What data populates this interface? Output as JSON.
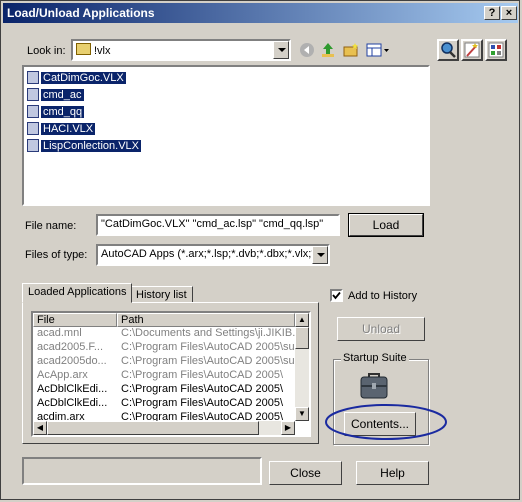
{
  "window": {
    "title": "Load/Unload Applications",
    "help_glyph": "?",
    "close_glyph": "×"
  },
  "look_in": {
    "label": "Look in:",
    "value": "!vlx"
  },
  "files": [
    "CatDimGoc.VLX",
    "cmd_ac",
    "cmd_qq",
    "HACI.VLX",
    "LispConlection.VLX"
  ],
  "file_name": {
    "label": "File name:",
    "value": "\"CatDimGoc.VLX\" \"cmd_ac.lsp\" \"cmd_qq.lsp\""
  },
  "file_type": {
    "label": "Files of type:",
    "value": "AutoCAD Apps (*.arx;*.lsp;*.dvb;*.dbx;*.vlx;*."
  },
  "buttons": {
    "load": "Load",
    "unload": "Unload",
    "contents": "Contents...",
    "close": "Close",
    "help": "Help"
  },
  "tabs": [
    "Loaded Applications",
    "History list"
  ],
  "add_to_history": {
    "label": "Add to History",
    "checked": true
  },
  "startup_suite": {
    "label": "Startup Suite"
  },
  "table": {
    "columns": [
      "File",
      "Path"
    ],
    "rows": [
      {
        "file": "acad.mnl",
        "path": "C:\\Documents and Settings\\ji.JIKIB...",
        "gray": true
      },
      {
        "file": "acad2005.F...",
        "path": "C:\\Program Files\\AutoCAD 2005\\su...",
        "gray": true
      },
      {
        "file": "acad2005do...",
        "path": "C:\\Program Files\\AutoCAD 2005\\su...",
        "gray": true
      },
      {
        "file": "AcApp.arx",
        "path": "C:\\Program Files\\AutoCAD 2005\\",
        "gray": true
      },
      {
        "file": "AcDblClkEdi...",
        "path": "C:\\Program Files\\AutoCAD 2005\\",
        "gray": false
      },
      {
        "file": "AcDblClkEdi...",
        "path": "C:\\Program Files\\AutoCAD 2005\\",
        "gray": false
      },
      {
        "file": "acdim.arx",
        "path": "C:\\Program Files\\AutoCAD 2005\\",
        "gray": false
      }
    ]
  },
  "status": {
    "value": ""
  },
  "colors": {
    "selection": "#0a246a",
    "highlight_ellipse": "#1a2aa0"
  }
}
